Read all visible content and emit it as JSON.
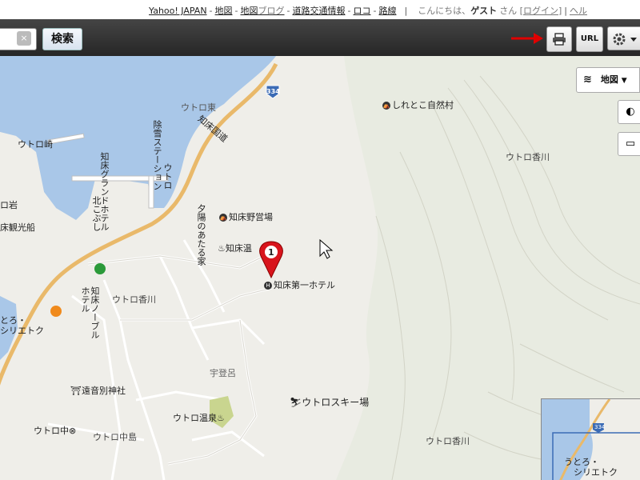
{
  "topbar": {
    "links": [
      "Yahoo! JAPAN",
      "地図",
      "地図",
      "道路交通情報",
      "ロコ",
      "路線"
    ],
    "blog_suffix": "ブログ",
    "greeting_prefix": "こんにちは、",
    "guest": "ゲスト",
    "greeting_suffix": "さん [",
    "login": "ログイン",
    "close_bracket": "]",
    "help": "ヘル"
  },
  "toolbar": {
    "search_label": "検索",
    "clear_label": "×",
    "url_label": "URL"
  },
  "map": {
    "layer_label": "地図",
    "route_number": "334",
    "minimap_route": "334",
    "marker_number": "1",
    "labels": {
      "utoro_higashi": "ウトロ東",
      "utoro_saki": "ウトロ崎",
      "shiretoko_shizenmura": "しれとこ自然村",
      "utoro_kagawa_1": "ウトロ香川",
      "utoro_kagawa_2": "ウトロ香川",
      "utoro_kagawa_3": "ウトロ香川",
      "iwa": "ロ岩",
      "kankosen": "床観光船",
      "yaeijo": "知床野営場",
      "onsen_short": "知床温",
      "daiichi_hotel": "知床第一ホテル",
      "toro_eki": "とろ・",
      "sirietok": "シリエトク",
      "ubushi": "宇登呂",
      "tooto_jinja": "遠音別神社",
      "ski": "ウトロスキー場",
      "utoro_onsen": "ウトロ温泉",
      "utoro_chu": "ウトロ中",
      "utoro_nakajima": "ウトロ中島",
      "minimap_station_1": "うとろ・",
      "minimap_station_2": "シリエトク"
    },
    "vertical_labels": {
      "kokudo": "知床国道",
      "josetsu": "除雪ステーション",
      "grand_hotel": "知床グランドホテル",
      "kitakobushi": "北こぶし",
      "utoro_v": "ウトロ",
      "yuhi": "夕陽のあたる家",
      "hotel_noble_1": "ホテル",
      "hotel_noble_2": "知床ノーブル"
    }
  },
  "colors": {
    "sea": "#a9c7e8",
    "land": "#efeee9",
    "road_main": "#e9b96a",
    "road_minor": "#ffffff",
    "marker": "#d8141c"
  }
}
